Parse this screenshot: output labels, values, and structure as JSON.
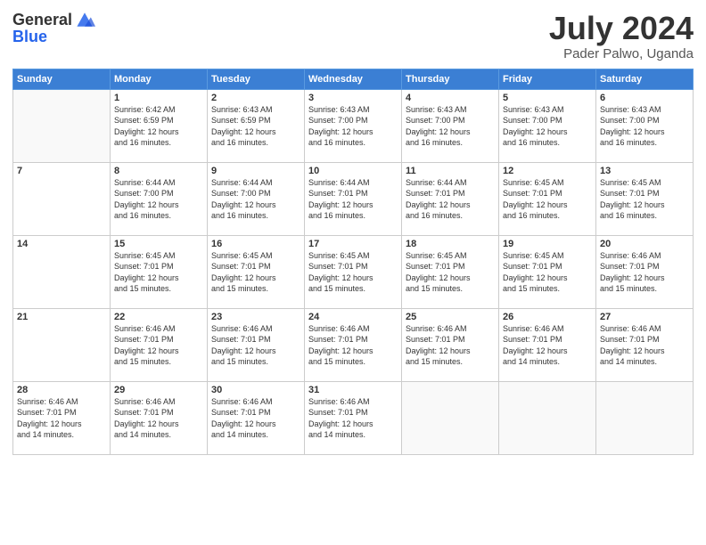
{
  "logo": {
    "general": "General",
    "blue": "Blue"
  },
  "title": "July 2024",
  "subtitle": "Pader Palwo, Uganda",
  "days_header": [
    "Sunday",
    "Monday",
    "Tuesday",
    "Wednesday",
    "Thursday",
    "Friday",
    "Saturday"
  ],
  "weeks": [
    [
      {
        "day": "",
        "info": ""
      },
      {
        "day": "1",
        "info": "Sunrise: 6:42 AM\nSunset: 6:59 PM\nDaylight: 12 hours\nand 16 minutes."
      },
      {
        "day": "2",
        "info": "Sunrise: 6:43 AM\nSunset: 6:59 PM\nDaylight: 12 hours\nand 16 minutes."
      },
      {
        "day": "3",
        "info": "Sunrise: 6:43 AM\nSunset: 7:00 PM\nDaylight: 12 hours\nand 16 minutes."
      },
      {
        "day": "4",
        "info": "Sunrise: 6:43 AM\nSunset: 7:00 PM\nDaylight: 12 hours\nand 16 minutes."
      },
      {
        "day": "5",
        "info": "Sunrise: 6:43 AM\nSunset: 7:00 PM\nDaylight: 12 hours\nand 16 minutes."
      },
      {
        "day": "6",
        "info": "Sunrise: 6:43 AM\nSunset: 7:00 PM\nDaylight: 12 hours\nand 16 minutes."
      }
    ],
    [
      {
        "day": "7",
        "info": ""
      },
      {
        "day": "8",
        "info": "Sunrise: 6:44 AM\nSunset: 7:00 PM\nDaylight: 12 hours\nand 16 minutes."
      },
      {
        "day": "9",
        "info": "Sunrise: 6:44 AM\nSunset: 7:00 PM\nDaylight: 12 hours\nand 16 minutes."
      },
      {
        "day": "10",
        "info": "Sunrise: 6:44 AM\nSunset: 7:01 PM\nDaylight: 12 hours\nand 16 minutes."
      },
      {
        "day": "11",
        "info": "Sunrise: 6:44 AM\nSunset: 7:01 PM\nDaylight: 12 hours\nand 16 minutes."
      },
      {
        "day": "12",
        "info": "Sunrise: 6:45 AM\nSunset: 7:01 PM\nDaylight: 12 hours\nand 16 minutes."
      },
      {
        "day": "13",
        "info": "Sunrise: 6:45 AM\nSunset: 7:01 PM\nDaylight: 12 hours\nand 16 minutes."
      }
    ],
    [
      {
        "day": "14",
        "info": ""
      },
      {
        "day": "15",
        "info": "Sunrise: 6:45 AM\nSunset: 7:01 PM\nDaylight: 12 hours\nand 15 minutes."
      },
      {
        "day": "16",
        "info": "Sunrise: 6:45 AM\nSunset: 7:01 PM\nDaylight: 12 hours\nand 15 minutes."
      },
      {
        "day": "17",
        "info": "Sunrise: 6:45 AM\nSunset: 7:01 PM\nDaylight: 12 hours\nand 15 minutes."
      },
      {
        "day": "18",
        "info": "Sunrise: 6:45 AM\nSunset: 7:01 PM\nDaylight: 12 hours\nand 15 minutes."
      },
      {
        "day": "19",
        "info": "Sunrise: 6:45 AM\nSunset: 7:01 PM\nDaylight: 12 hours\nand 15 minutes."
      },
      {
        "day": "20",
        "info": "Sunrise: 6:46 AM\nSunset: 7:01 PM\nDaylight: 12 hours\nand 15 minutes."
      }
    ],
    [
      {
        "day": "21",
        "info": ""
      },
      {
        "day": "22",
        "info": "Sunrise: 6:46 AM\nSunset: 7:01 PM\nDaylight: 12 hours\nand 15 minutes."
      },
      {
        "day": "23",
        "info": "Sunrise: 6:46 AM\nSunset: 7:01 PM\nDaylight: 12 hours\nand 15 minutes."
      },
      {
        "day": "24",
        "info": "Sunrise: 6:46 AM\nSunset: 7:01 PM\nDaylight: 12 hours\nand 15 minutes."
      },
      {
        "day": "25",
        "info": "Sunrise: 6:46 AM\nSunset: 7:01 PM\nDaylight: 12 hours\nand 15 minutes."
      },
      {
        "day": "26",
        "info": "Sunrise: 6:46 AM\nSunset: 7:01 PM\nDaylight: 12 hours\nand 14 minutes."
      },
      {
        "day": "27",
        "info": "Sunrise: 6:46 AM\nSunset: 7:01 PM\nDaylight: 12 hours\nand 14 minutes."
      }
    ],
    [
      {
        "day": "28",
        "info": "Sunrise: 6:46 AM\nSunset: 7:01 PM\nDaylight: 12 hours\nand 14 minutes."
      },
      {
        "day": "29",
        "info": "Sunrise: 6:46 AM\nSunset: 7:01 PM\nDaylight: 12 hours\nand 14 minutes."
      },
      {
        "day": "30",
        "info": "Sunrise: 6:46 AM\nSunset: 7:01 PM\nDaylight: 12 hours\nand 14 minutes."
      },
      {
        "day": "31",
        "info": "Sunrise: 6:46 AM\nSunset: 7:01 PM\nDaylight: 12 hours\nand 14 minutes."
      },
      {
        "day": "",
        "info": ""
      },
      {
        "day": "",
        "info": ""
      },
      {
        "day": "",
        "info": ""
      }
    ]
  ]
}
